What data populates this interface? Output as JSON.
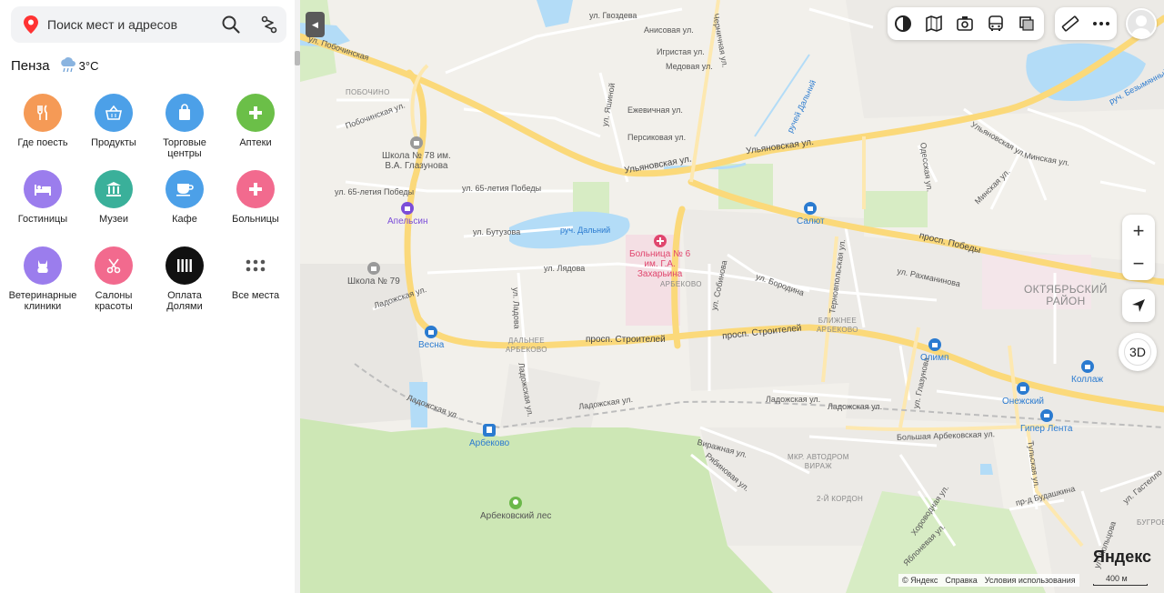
{
  "search": {
    "placeholder": "Поиск мест и адресов"
  },
  "weather": {
    "city": "Пенза",
    "temp": "3°C",
    "icon": "rain-cloud-icon"
  },
  "categories": [
    {
      "label_line1": "Где поесть",
      "label_line2": "",
      "icon": "fork-knife-icon",
      "color": "#f59a56"
    },
    {
      "label_line1": "Продукты",
      "label_line2": "",
      "icon": "basket-icon",
      "color": "#4ca0e8"
    },
    {
      "label_line1": "Торговые",
      "label_line2": "центры",
      "icon": "shopping-bag-icon",
      "color": "#4ca0e8"
    },
    {
      "label_line1": "Аптеки",
      "label_line2": "",
      "icon": "plus-icon",
      "color": "#6bbf48"
    },
    {
      "label_line1": "Гостиницы",
      "label_line2": "",
      "icon": "bed-icon",
      "color": "#9b7ded"
    },
    {
      "label_line1": "Музеи",
      "label_line2": "",
      "icon": "museum-icon",
      "color": "#3ab09a"
    },
    {
      "label_line1": "Кафе",
      "label_line2": "",
      "icon": "coffee-cup-icon",
      "color": "#4ca0e8"
    },
    {
      "label_line1": "Больницы",
      "label_line2": "",
      "icon": "plus-icon",
      "color": "#f26a8e"
    },
    {
      "label_line1": "Ветеринарные",
      "label_line2": "клиники",
      "icon": "cat-icon",
      "color": "#9b7ded"
    },
    {
      "label_line1": "Салоны",
      "label_line2": "красоты",
      "icon": "scissors-icon",
      "color": "#f26a8e"
    },
    {
      "label_line1": "Оплата",
      "label_line2": "Долями",
      "icon": "dolyami-icon",
      "color": "#111111"
    },
    {
      "label_line1": "Все места",
      "label_line2": "",
      "icon": "grid-dots-icon",
      "color": "#ffffff"
    }
  ],
  "map": {
    "streets": [
      {
        "text": "ул. Гвоздева"
      },
      {
        "text": "Анисовая ул."
      },
      {
        "text": "Игристая ул."
      },
      {
        "text": "Медовая ул."
      },
      {
        "text": "Черничная ул."
      },
      {
        "text": "ул. Побочинская"
      },
      {
        "text": "Побочинская ул."
      },
      {
        "text": "Ежевичная ул."
      },
      {
        "text": "ул. Яшиной"
      },
      {
        "text": "Персиковая ул."
      },
      {
        "text": "ручей Дальний"
      },
      {
        "text": "Ульяновская ул."
      },
      {
        "text": "Ульяновская ул."
      },
      {
        "text": "ул. 65-летия Победы"
      },
      {
        "text": "ул. 65-летия Победы"
      },
      {
        "text": "ул. Бутузова"
      },
      {
        "text": "руч. Дальний"
      },
      {
        "text": "ул. Лядова"
      },
      {
        "text": "Ладожская ул."
      },
      {
        "text": "ул. Ладова"
      },
      {
        "text": "Ладожская ул."
      },
      {
        "text": "просп. Строителей"
      },
      {
        "text": "просп. Строителей"
      },
      {
        "text": "Ладожская ул."
      },
      {
        "text": "Ладожская ул."
      },
      {
        "text": "Ладожская ул."
      },
      {
        "text": "Ладожская ул."
      },
      {
        "text": "ул. Собинова"
      },
      {
        "text": "ул. Бородина"
      },
      {
        "text": "Терновпольская ул."
      },
      {
        "text": "просп. Победы"
      },
      {
        "text": "ул. Рахманинова"
      },
      {
        "text": "Одесская ул."
      },
      {
        "text": "Ульяновская ул."
      },
      {
        "text": "Минская ул."
      },
      {
        "text": "Минская ул."
      },
      {
        "text": "ул. Глазунова"
      },
      {
        "text": "Большая Арбековская ул."
      },
      {
        "text": "Виражная ул."
      },
      {
        "text": "Рябиновая ул."
      },
      {
        "text": "Хороводная ул."
      },
      {
        "text": "Яблоневая ул."
      },
      {
        "text": "Тульская ул."
      },
      {
        "text": "ул. Кольцова"
      },
      {
        "text": "пр-д Будашкина"
      },
      {
        "text": "ул. Гастелло"
      },
      {
        "text": "руч. Безымянный"
      }
    ],
    "pois": [
      {
        "text": "Школа № 78 им.\nВ.А. Глазунова",
        "color": "#555555"
      },
      {
        "text": "Апельсин",
        "color": "#7b4dd8"
      },
      {
        "text": "Школа № 79",
        "color": "#555555"
      },
      {
        "text": "Больница № 6\nим. Г.А.\nЗахарьина",
        "color": "#e0466e"
      },
      {
        "text": "Салют",
        "color": "#2b7bd0"
      },
      {
        "text": "Весна",
        "color": "#2b7bd0"
      },
      {
        "text": "Олимп",
        "color": "#2b7bd0"
      },
      {
        "text": "Коллаж",
        "color": "#2b7bd0"
      },
      {
        "text": "Онежский",
        "color": "#2b7bd0"
      },
      {
        "text": "Гипер Лента",
        "color": "#2b7bd0"
      },
      {
        "text": "Арбеково",
        "color": "#2b7bd0"
      },
      {
        "text": "Арбековский лес",
        "color": "#555555"
      }
    ],
    "districts": [
      {
        "text": "ПОБОЧИНО"
      },
      {
        "text": "АРБЕКОВО"
      },
      {
        "text": "ДАЛЬНЕЕ\nАРБЕКОВО"
      },
      {
        "text": "БЛИЖНЕЕ\nАРБЕКОВО"
      },
      {
        "text": "МКР. АВТОДРОМ\nВИРАЖ"
      },
      {
        "text": "2-Й КОРДОН"
      },
      {
        "text": "ОКТЯБРЬСКИЙ\nРАЙОН"
      },
      {
        "text": "БУГРОВ"
      }
    ],
    "controls": {
      "zoom_in": "+",
      "zoom_out": "−",
      "btn_3d": "3D"
    },
    "footer": {
      "logo": "Яндекс",
      "copyright": "© Яндекс",
      "help": "Справка",
      "terms": "Условия использования",
      "scale": "400 м"
    },
    "colors": {
      "water": "#b3dcf7",
      "forest": "#cfe8b9",
      "major_road": "#fbd97a",
      "minor_road": "#ffffff",
      "residential": "#e9e7e3"
    }
  }
}
